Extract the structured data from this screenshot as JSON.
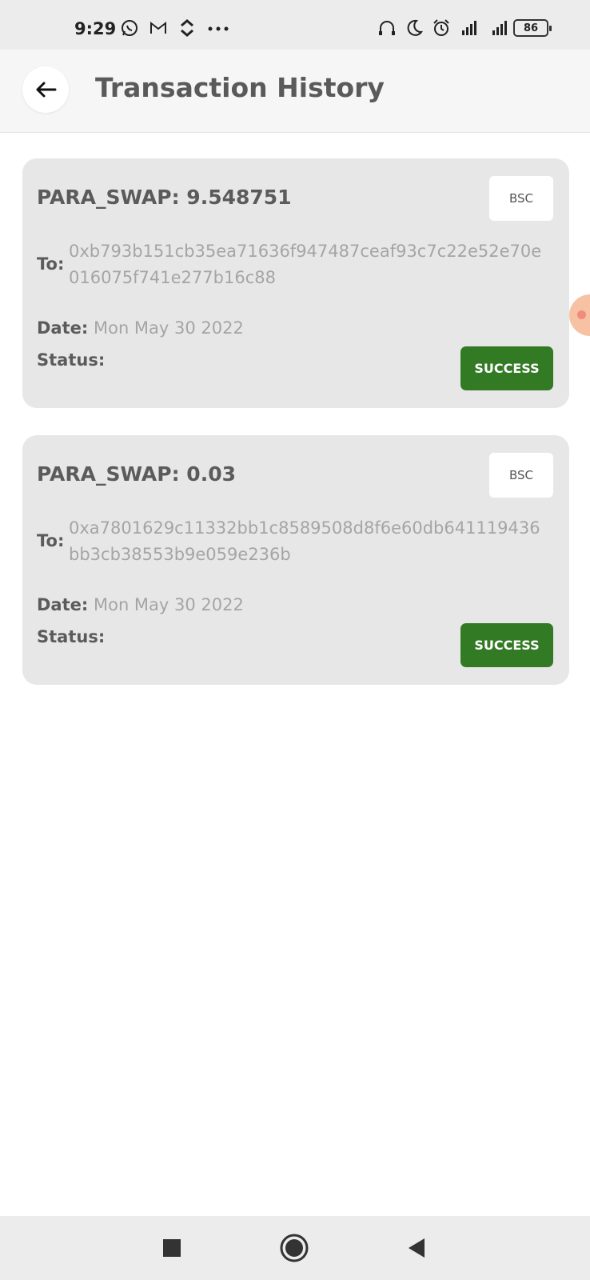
{
  "status_bar": {
    "time": "9:29",
    "battery": "86",
    "left_icons": [
      "whatsapp-icon",
      "gmail-icon",
      "updown-icon",
      "more-icon"
    ],
    "right_icons": [
      "headphones-icon",
      "moon-icon",
      "alarm-icon",
      "signal-r-icon",
      "signal-4g-icon"
    ]
  },
  "header": {
    "title": "Transaction History"
  },
  "transactions": [
    {
      "title": "PARA_SWAP: 9.548751",
      "network": "BSC",
      "to_label": "To:",
      "address": "0xb793b151cb35ea71636f947487ceaf93c7c22e52e70e016075f741e277b16c88",
      "date_label": "Date:",
      "date": "Mon May 30 2022",
      "status_label": "Status:",
      "status": "SUCCESS"
    },
    {
      "title": "PARA_SWAP: 0.03",
      "network": "BSC",
      "to_label": "To:",
      "address": "0xa7801629c11332bb1c8589508d8f6e60db641119436bb3cb38553b9e059e236b",
      "date_label": "Date:",
      "date": "Mon May 30 2022",
      "status_label": "Status:",
      "status": "SUCCESS"
    }
  ],
  "colors": {
    "success": "#337a25",
    "card_bg": "#e7e7e7",
    "muted_text": "#a5a5a5"
  },
  "nav": {
    "icons": [
      "recents-icon",
      "home-icon",
      "back-nav-icon"
    ]
  }
}
